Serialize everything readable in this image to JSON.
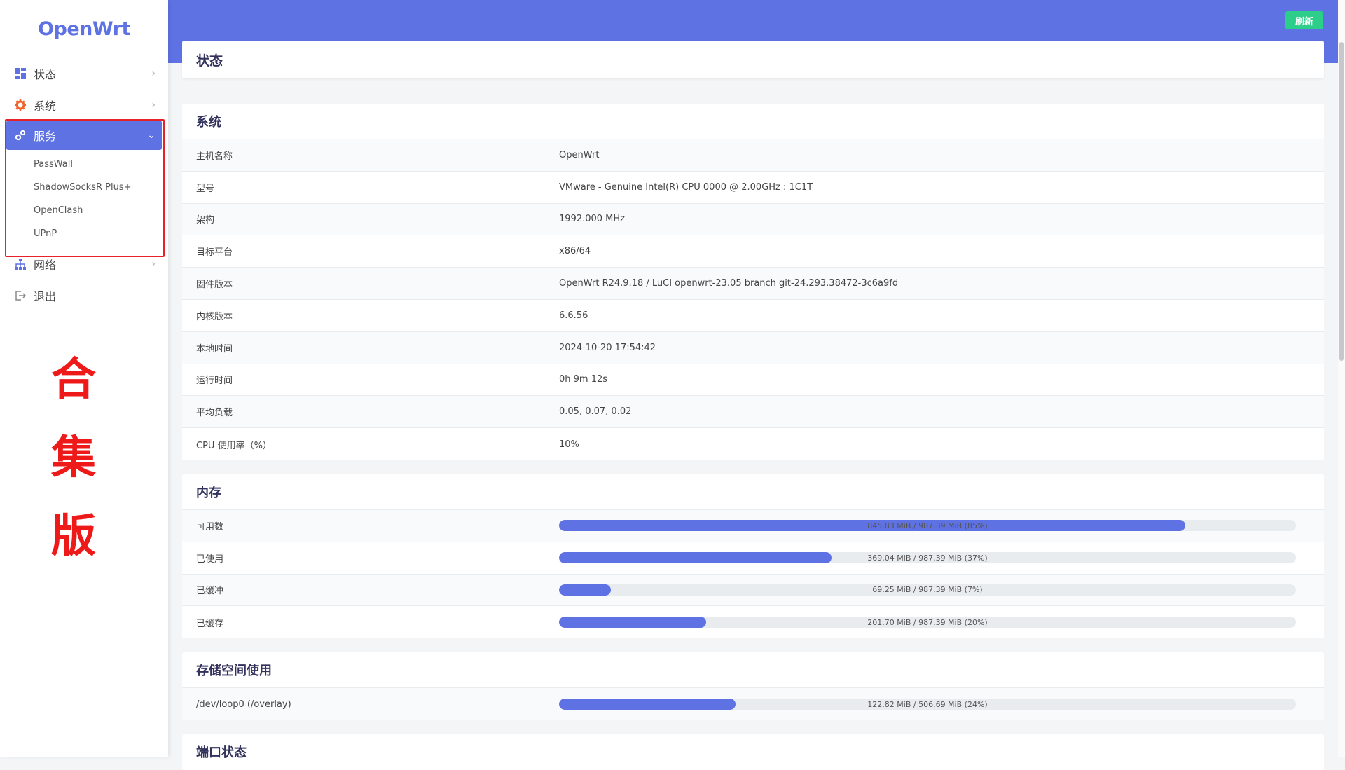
{
  "app": {
    "logo": "OpenWrt",
    "refresh_label": "刷新",
    "page_title": "状态"
  },
  "sidebar": {
    "items": [
      {
        "label": "状态",
        "icon": "dashboard-icon"
      },
      {
        "label": "系统",
        "icon": "gear-icon"
      },
      {
        "label": "服务",
        "icon": "gears-icon",
        "expanded": true,
        "children": [
          "PassWall",
          "ShadowSocksR Plus+",
          "OpenClash",
          "UPnP"
        ]
      },
      {
        "label": "网络",
        "icon": "network-icon"
      },
      {
        "label": "退出",
        "icon": "logout-icon"
      }
    ]
  },
  "overlay_text": [
    "合",
    "集",
    "版"
  ],
  "system": {
    "title": "系统",
    "rows": [
      {
        "key": "主机名称",
        "value": "OpenWrt"
      },
      {
        "key": "型号",
        "value": "VMware - Genuine Intel(R) CPU 0000 @ 2.00GHz : 1C1T"
      },
      {
        "key": "架构",
        "value": "1992.000 MHz"
      },
      {
        "key": "目标平台",
        "value": "x86/64"
      },
      {
        "key": "固件版本",
        "value": "OpenWrt R24.9.18 / LuCI openwrt-23.05 branch git-24.293.38472-3c6a9fd"
      },
      {
        "key": "内核版本",
        "value": "6.6.56"
      },
      {
        "key": "本地时间",
        "value": "2024-10-20 17:54:42"
      },
      {
        "key": "运行时间",
        "value": "0h 9m 12s"
      },
      {
        "key": "平均负载",
        "value": "0.05, 0.07, 0.02"
      },
      {
        "key": "CPU 使用率（%）",
        "value": "10%"
      }
    ]
  },
  "memory": {
    "title": "内存",
    "rows": [
      {
        "key": "可用数",
        "text": "845.83 MiB / 987.39 MiB (85%)",
        "percent": 85
      },
      {
        "key": "已使用",
        "text": "369.04 MiB / 987.39 MiB (37%)",
        "percent": 37
      },
      {
        "key": "已缓冲",
        "text": "69.25 MiB / 987.39 MiB (7%)",
        "percent": 7
      },
      {
        "key": "已缓存",
        "text": "201.70 MiB / 987.39 MiB (20%)",
        "percent": 20
      }
    ]
  },
  "storage": {
    "title": "存储空间使用",
    "rows": [
      {
        "key": "/dev/loop0 (/overlay)",
        "text": "122.82 MiB / 506.69 MiB (24%)",
        "percent": 24
      }
    ]
  },
  "ports": {
    "title": "端口状态"
  },
  "colors": {
    "accent": "#5e72e4",
    "refresh": "#2dce89",
    "highlight": "#e8202a"
  }
}
